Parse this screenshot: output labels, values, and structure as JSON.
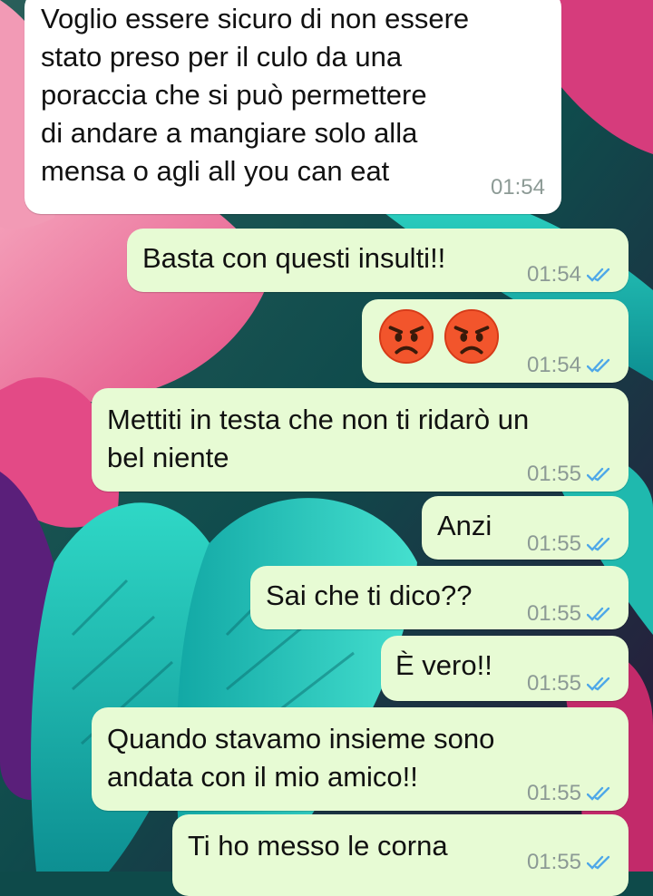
{
  "colors": {
    "incoming_bubble": "#ffffff",
    "outgoing_bubble": "#e7fbd4",
    "timestamp": "#8c9a95",
    "read_ticks": "#4fa8e8"
  },
  "messages": [
    {
      "direction": "incoming",
      "text": "Voglio essere sicuro di non essere\nstato preso per il culo da una\nporaccia che si può permettere\ndi andare a mangiare solo alla\nmensa o agli all you can eat",
      "time": "01:54"
    },
    {
      "direction": "outgoing",
      "text": "Basta con questi insulti!!",
      "time": "01:54",
      "status": "read"
    },
    {
      "direction": "outgoing",
      "emoji": [
        "angry-face",
        "angry-face"
      ],
      "time": "01:54",
      "status": "read"
    },
    {
      "direction": "outgoing",
      "text": "Mettiti in testa che non ti ridarò un\nbel niente",
      "time": "01:55",
      "status": "read"
    },
    {
      "direction": "outgoing",
      "text": "Anzi",
      "time": "01:55",
      "status": "read"
    },
    {
      "direction": "outgoing",
      "text": "Sai che ti dico??",
      "time": "01:55",
      "status": "read"
    },
    {
      "direction": "outgoing",
      "text": "È vero!!",
      "time": "01:55",
      "status": "read"
    },
    {
      "direction": "outgoing",
      "text": "Quando stavamo insieme sono\nandata con il mio amico!!",
      "time": "01:55",
      "status": "read"
    },
    {
      "direction": "outgoing",
      "text": "Ti ho messo le corna",
      "time": "01:55",
      "status": "read"
    }
  ]
}
